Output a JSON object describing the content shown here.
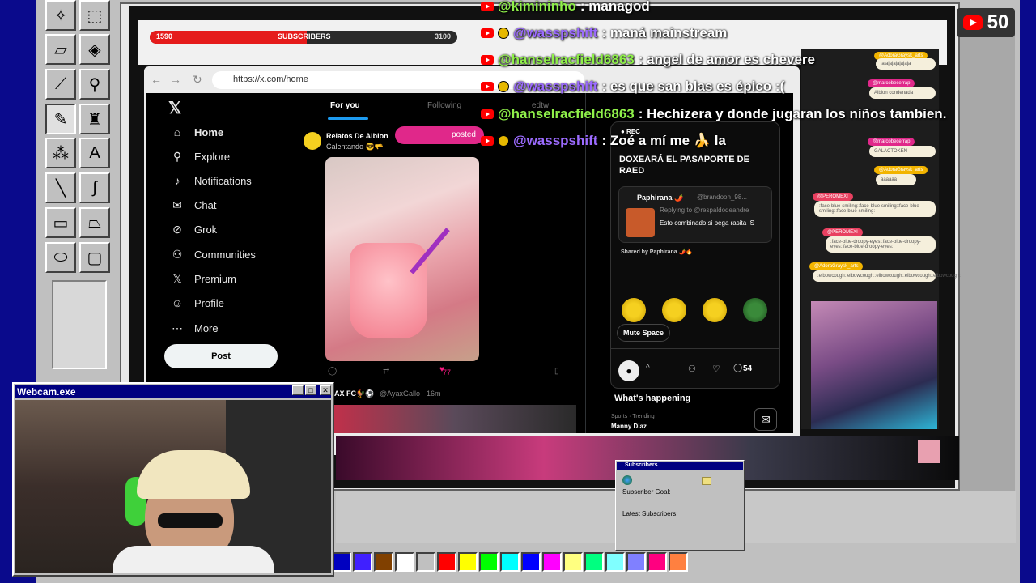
{
  "viewers": {
    "count": "50"
  },
  "subgoal": {
    "current": "1590",
    "label": "SUBSCRIBERS",
    "target": "3100",
    "fill_fraction": 0.51
  },
  "browser": {
    "url": "https://x.com/home"
  },
  "x_sidebar": {
    "logo": "𝕏",
    "items": [
      {
        "label": "Home",
        "icon": "home-icon",
        "glyph": "⌂"
      },
      {
        "label": "Explore",
        "icon": "search-icon",
        "glyph": "⚲"
      },
      {
        "label": "Notifications",
        "icon": "bell-icon",
        "glyph": "♪"
      },
      {
        "label": "Chat",
        "icon": "mail-icon",
        "glyph": "✉"
      },
      {
        "label": "Grok",
        "icon": "grok-icon",
        "glyph": "⊘"
      },
      {
        "label": "Communities",
        "icon": "people-icon",
        "glyph": "⚇"
      },
      {
        "label": "Premium",
        "icon": "x-logo-icon",
        "glyph": "𝕏"
      },
      {
        "label": "Profile",
        "icon": "person-icon",
        "glyph": "☺"
      },
      {
        "label": "More",
        "icon": "more-icon",
        "glyph": "⋯"
      }
    ],
    "post_label": "Post"
  },
  "feed": {
    "tab_for_you": "For you",
    "tab_following": "Following",
    "tab_edtw": "edtw",
    "post1_author": "Relatos De Albion",
    "post1_text": "Calentando 😎🫳",
    "posted_label": "posted",
    "post1_likes": "77",
    "post2_author": "AX FC🐓⚽",
    "post2_handle": "@AyaxGallo · 16m"
  },
  "space": {
    "rec": "● REC",
    "title": "DOXEARÁ EL PASAPORTE DE RAED",
    "card_user": "Paphirana 🌶️",
    "card_handle": "@brandoon_98...",
    "card_reply": "Replying to @respaldodeandre",
    "card_text": "Esto combinado si pega rasita :S",
    "shared_by": "Shared by Paphirana 🌶️🔥",
    "mute_label": "Mute Space",
    "comments": "54",
    "whats_happening": "What's happening",
    "trend_meta": "Sports · Trending",
    "trend_name": "Manny Diaz"
  },
  "right_chat": {
    "messages": [
      {
        "tag": "@AdoraGraysk_arts",
        "text": "jajajajajajajaja"
      },
      {
        "tag": "@marcobecerrap",
        "text": "Albion condenada"
      },
      {
        "tag": "@marcobecerrap",
        "text": "GALACTOKEN"
      },
      {
        "tag": "@AdoraGraysk_arts",
        "text": "aaaaaa"
      },
      {
        "tag": "@PEROMEXI",
        "text": ":face-blue-smiling::face-blue-smiling::face-blue-smiling::face-blue-smiling:"
      },
      {
        "tag": "@PEROMEXI",
        "text": ":face-blue-droopy-eyes::face-blue-droopy-eyes::face-blue-droopy-eyes:"
      },
      {
        "tag": "@AdoraGraysk_arts",
        "text": ":elbowcough::elbowcough::elbowcough::elbowcough::elbowcough:"
      }
    ]
  },
  "overlay_chat": [
    {
      "user": "@kimininho",
      "text": ": managod",
      "badge": false,
      "color": "green"
    },
    {
      "user": "@wasspshift",
      "text": ": maná mainstream",
      "badge": true,
      "color": "purple"
    },
    {
      "user": "@hanselracfield6863",
      "text": ": angel de amor es chevere",
      "badge": false,
      "color": "green"
    },
    {
      "user": "@wasspshift",
      "text": ": es que san blas es épico :(",
      "badge": true,
      "color": "purple"
    },
    {
      "user": "@hanselracfield6863",
      "text": ": Hechizera y donde jugaran los niños tambien.",
      "badge": false,
      "color": "green"
    },
    {
      "user": "@wasspshift",
      "text": ": Zoé a mí me 🍌 la",
      "badge": true,
      "color": "purple"
    }
  ],
  "webcam": {
    "title": "Webcam.exe",
    "min": "_",
    "max": "□",
    "close": "✕"
  },
  "subs_dialog": {
    "title": "Subscribers",
    "goal_label": "Subscriber Goal:",
    "latest_label": "Latest Subscribers:"
  },
  "palette": [
    "#0000c0",
    "#4020ff",
    "#804000",
    "#ffffff",
    "#c0c0c0",
    "#ff0000",
    "#ffff00",
    "#00ff00",
    "#00ffff",
    "#0000ff",
    "#ff00ff",
    "#ffff80",
    "#00ff80",
    "#80ffff",
    "#8080ff",
    "#ff0080",
    "#ff8040"
  ],
  "tools": [
    "select-star-icon",
    "select-rect-icon",
    "eraser-icon",
    "fill-icon",
    "eyedropper-icon",
    "magnifier-icon",
    "pencil-icon",
    "brush-icon",
    "airbrush-icon",
    "text-icon",
    "line-icon",
    "curve-icon",
    "rectangle-icon",
    "polygon-icon",
    "ellipse-icon",
    "rounded-rect-icon"
  ]
}
